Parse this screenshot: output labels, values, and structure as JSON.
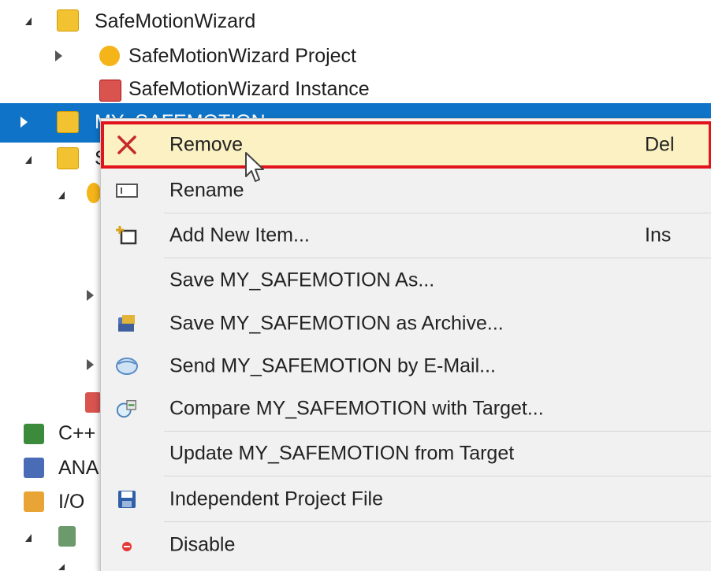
{
  "tree": {
    "safemotion_wizard": "SafeMotionWizard",
    "safemotion_wizard_project": "SafeMotionWizard Project",
    "safemotion_wizard_instance": "SafeMotionWizard Instance",
    "selected_item_fragment": "MY_SAFEMOTION",
    "partial_item_s": "S",
    "partial_cpp": "C++",
    "partial_ana": "ANA",
    "partial_io": "I/O"
  },
  "context_menu": {
    "items": [
      {
        "label": "Remove",
        "shortcut": "Del",
        "icon": "red-x-icon"
      },
      {
        "label": "Rename",
        "shortcut": "",
        "icon": "rename-icon"
      },
      {
        "label": "Add New Item...",
        "shortcut": "Ins",
        "icon": "add-item-icon"
      },
      {
        "label": "Save MY_SAFEMOTION As...",
        "shortcut": "",
        "icon": ""
      },
      {
        "label": "Save MY_SAFEMOTION as Archive...",
        "shortcut": "",
        "icon": "archive-icon"
      },
      {
        "label": "Send MY_SAFEMOTION by E-Mail...",
        "shortcut": "",
        "icon": "mail-icon"
      },
      {
        "label": "Compare MY_SAFEMOTION with Target...",
        "shortcut": "",
        "icon": "compare-icon"
      },
      {
        "label": "Update MY_SAFEMOTION from Target",
        "shortcut": "",
        "icon": ""
      },
      {
        "label": "Independent Project File",
        "shortcut": "",
        "icon": "save-disk-icon"
      },
      {
        "label": "Disable",
        "shortcut": "",
        "icon": "disable-dot-icon"
      }
    ]
  },
  "colors": {
    "selection": "#0f74c7",
    "highlight_fill": "#fbf1c2",
    "highlight_border": "#e1131b",
    "menu_bg": "#f1f1f1"
  }
}
